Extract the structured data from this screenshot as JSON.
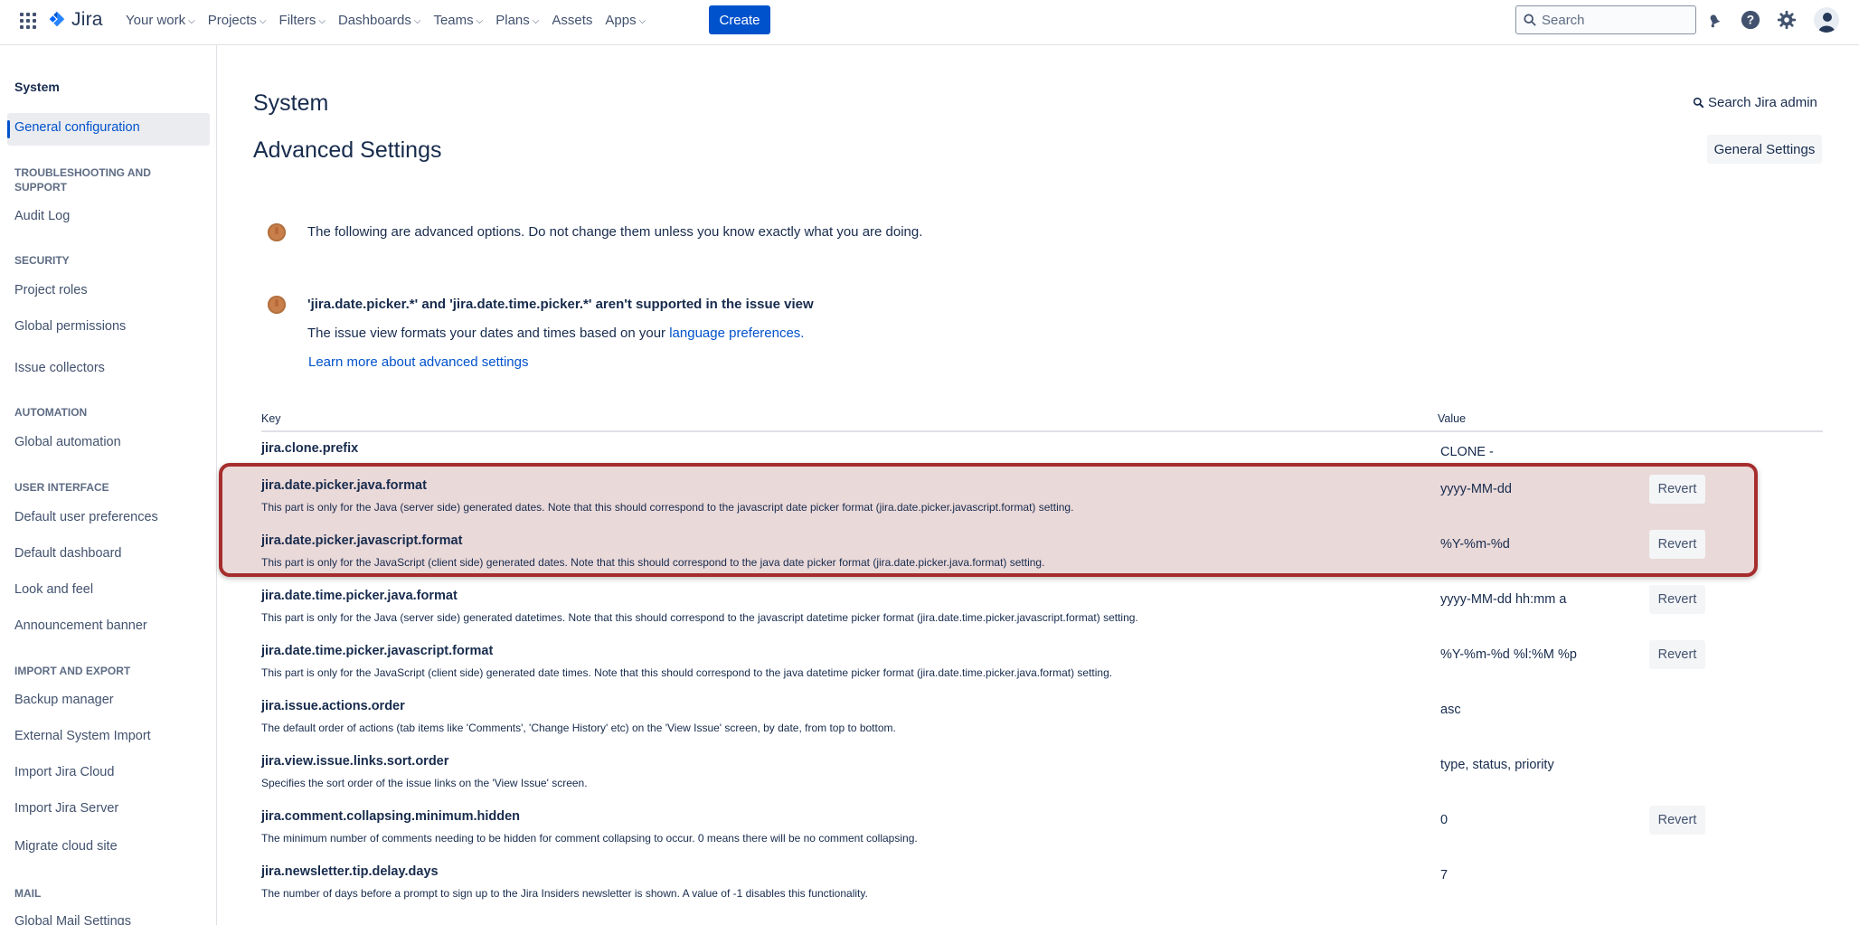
{
  "topnav": {
    "logo_text": "Jira",
    "items": [
      {
        "label": "Your work"
      },
      {
        "label": "Projects"
      },
      {
        "label": "Filters"
      },
      {
        "label": "Dashboards"
      },
      {
        "label": "Teams"
      },
      {
        "label": "Plans"
      },
      {
        "label": "Assets"
      },
      {
        "label": "Apps"
      }
    ],
    "create_label": "Create",
    "search_placeholder": "Search"
  },
  "sidebar": {
    "title": "System",
    "active_item": "General configuration",
    "sections": {
      "troubleshooting": "TROUBLESHOOTING AND SUPPORT",
      "security": "SECURITY",
      "automation": "AUTOMATION",
      "user_interface": "USER INTERFACE",
      "import_export": "IMPORT AND EXPORT",
      "mail": "MAIL"
    },
    "items": {
      "audit_log": "Audit Log",
      "project_roles": "Project roles",
      "global_permissions": "Global permissions",
      "issue_collectors": "Issue collectors",
      "global_automation": "Global automation",
      "default_user_preferences": "Default user preferences",
      "default_dashboard": "Default dashboard",
      "look_and_feel": "Look and feel",
      "announcement_banner": "Announcement banner",
      "backup_manager": "Backup manager",
      "external_system_import": "External System Import",
      "import_jira_cloud": "Import Jira Cloud",
      "import_jira_server": "Import Jira Server",
      "migrate_cloud_site": "Migrate cloud site",
      "global_mail_settings": "Global Mail Settings"
    }
  },
  "main": {
    "page_title": "System",
    "section_title": "Advanced Settings",
    "search_admin": "Search Jira admin",
    "general_settings": "General Settings",
    "warning_1": "The following are advanced options. Do not change them unless you know exactly what you are doing.",
    "warning_2_title": "'jira.date.picker.*' and 'jira.date.time.picker.*' aren't supported in the issue view",
    "warning_2_text": "The issue view formats your dates and times based on your ",
    "warning_2_link": "language preferences.",
    "learn_more": "Learn more about advanced settings",
    "table": {
      "col_key": "Key",
      "col_value": "Value",
      "revert_label": "Revert",
      "rows": [
        {
          "key": "jira.clone.prefix",
          "desc": "",
          "value": "CLONE -",
          "revert": false
        },
        {
          "key": "jira.date.picker.java.format",
          "desc": "This part is only for the Java (server side) generated dates. Note that this should correspond to the javascript date picker format (jira.date.picker.javascript.format) setting.",
          "value": "yyyy-MM-dd",
          "revert": true
        },
        {
          "key": "jira.date.picker.javascript.format",
          "desc": "This part is only for the JavaScript (client side) generated dates. Note that this should correspond to the java date picker format (jira.date.picker.java.format) setting.",
          "value": "%Y-%m-%d",
          "revert": true
        },
        {
          "key": "jira.date.time.picker.java.format",
          "desc": "This part is only for the Java (server side) generated datetimes. Note that this should correspond to the javascript datetime picker format (jira.date.time.picker.javascript.format) setting.",
          "value": "yyyy-MM-dd hh:mm a",
          "revert": true
        },
        {
          "key": "jira.date.time.picker.javascript.format",
          "desc": "This part is only for the JavaScript (client side) generated date times. Note that this should correspond to the java datetime picker format (jira.date.time.picker.java.format) setting.",
          "value": "%Y-%m-%d %l:%M %p",
          "revert": true
        },
        {
          "key": "jira.issue.actions.order",
          "desc": "The default order of actions (tab items like 'Comments', 'Change History' etc) on the 'View Issue' screen, by date, from top to bottom.",
          "value": "asc",
          "revert": false
        },
        {
          "key": "jira.view.issue.links.sort.order",
          "desc": "Specifies the sort order of the issue links on the 'View Issue' screen.",
          "value": "type, status, priority",
          "revert": false
        },
        {
          "key": "jira.comment.collapsing.minimum.hidden",
          "desc": "The minimum number of comments needing to be hidden for comment collapsing to occur. 0 means there will be no comment collapsing.",
          "value": "0",
          "revert": true
        },
        {
          "key": "jira.newsletter.tip.delay.days",
          "desc": "The number of days before a prompt to sign up to the Jira Insiders newsletter is shown. A value of -1 disables this functionality.",
          "value": "7",
          "revert": false
        }
      ]
    }
  },
  "colors": {
    "brand_blue": "#0052cc",
    "highlight_border": "#a62d2d",
    "warning_icon": "#c97f4a"
  }
}
